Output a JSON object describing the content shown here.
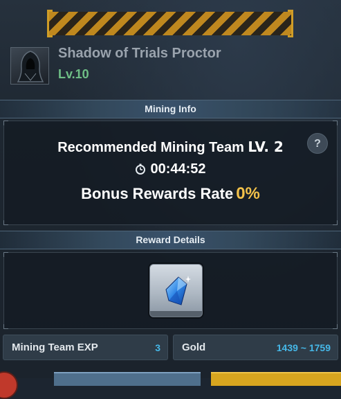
{
  "boss": {
    "name": "Shadow of Trials Proctor",
    "level": "Lv.10",
    "portrait_icon": "hooded-figure-icon"
  },
  "mining_info": {
    "header": "Mining Info",
    "recommended_label": "Recommended Mining Team",
    "recommended_level": "LV. 2",
    "timer": "00:44:52",
    "timer_icon": "stopwatch-icon",
    "bonus_label": "Bonus Rewards Rate",
    "bonus_value": "0%",
    "help_label": "?"
  },
  "reward_details": {
    "header": "Reward Details",
    "item_icon": "blue-crystal-icon"
  },
  "stats": {
    "exp_label": "Mining Team EXP",
    "exp_value": "3",
    "gold_label": "Gold",
    "gold_value": "1439 ~ 1759"
  },
  "colors": {
    "accent_gold": "#f2c14a",
    "level_green": "#6fbf86",
    "value_blue": "#46b8e8",
    "banner_amber": "#c88d1d"
  }
}
